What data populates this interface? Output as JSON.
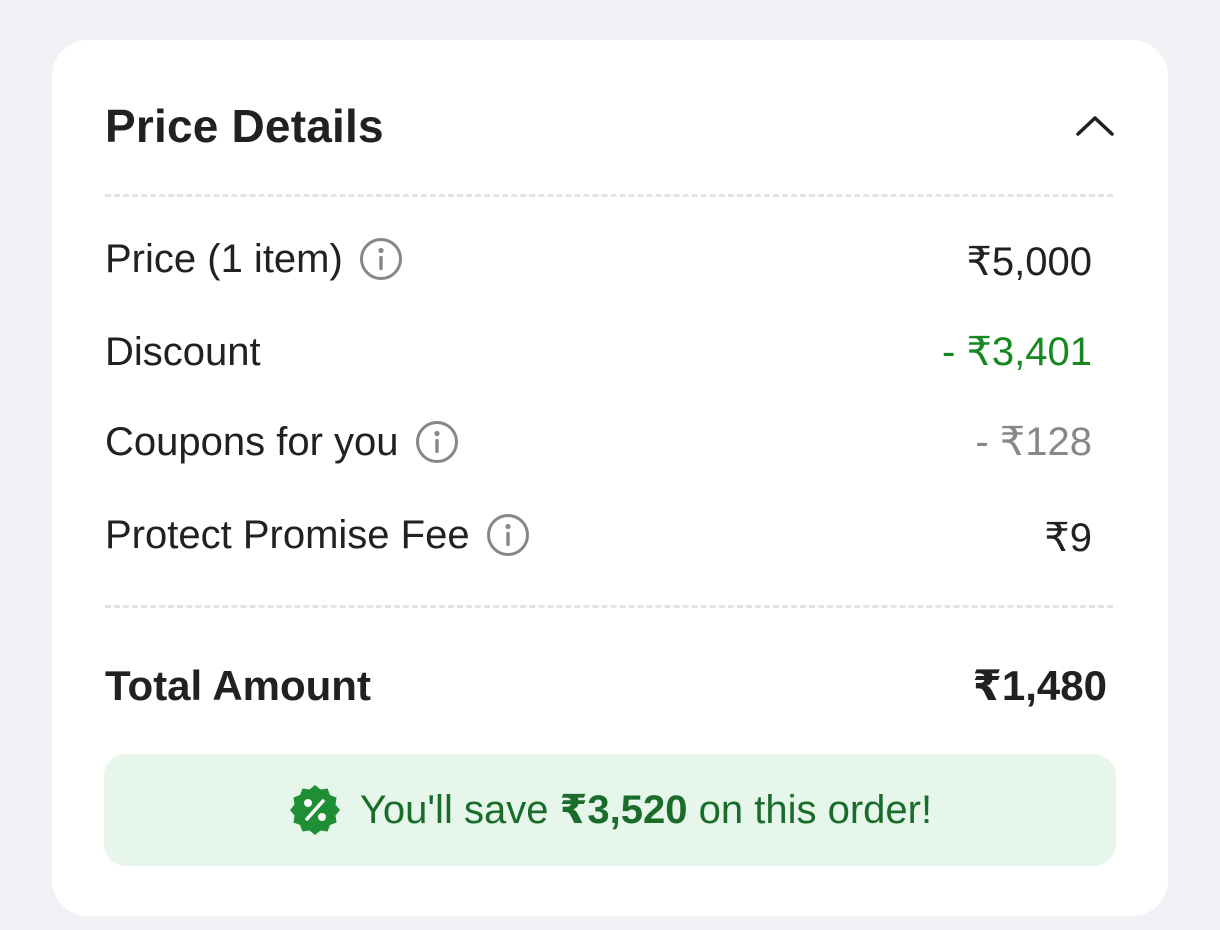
{
  "price_details": {
    "title": "Price Details",
    "rows": [
      {
        "label": "Price (1 item)",
        "value": "₹5,000",
        "has_info": true
      },
      {
        "label": "Discount",
        "value": "- ₹3,401",
        "has_info": false,
        "value_color": "#15881f"
      },
      {
        "label": "Coupons for you",
        "value": "- ₹128",
        "has_info": true,
        "value_color": "#878787"
      },
      {
        "label": "Protect Promise Fee",
        "value": "₹9",
        "has_info": true
      }
    ],
    "total": {
      "label": "Total Amount",
      "value": "₹1,480"
    },
    "savings": {
      "prefix": "You'll save ",
      "amount": "₹3,520",
      "suffix": " on this order!",
      "icon": "discount-percent-badge-icon"
    }
  },
  "colors": {
    "background": "#f1f2f6",
    "card": "#ffffff",
    "text": "#212121",
    "discount_green": "#15881f",
    "coupon_grey": "#878787",
    "savings_bg": "#e6f6ea",
    "savings_text": "#1a6c2a",
    "badge_green": "#1e8f35"
  }
}
